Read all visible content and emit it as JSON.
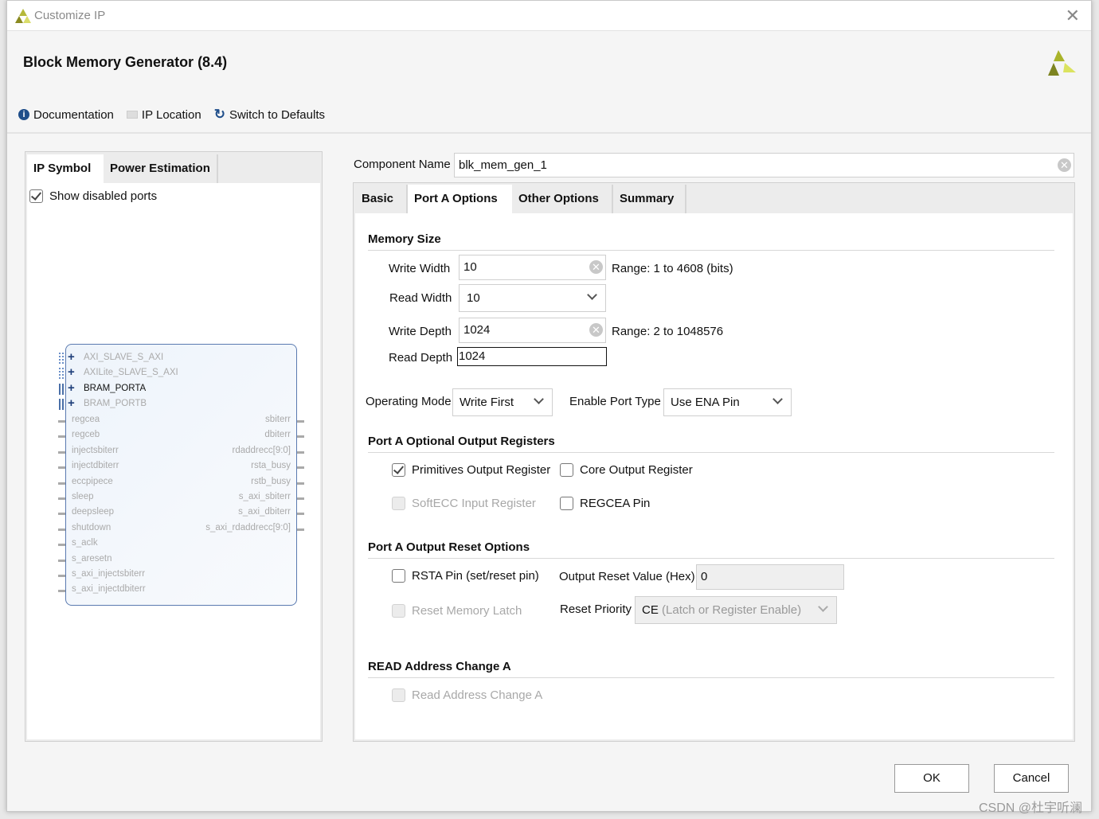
{
  "window": {
    "title": "Customize IP",
    "close_icon": "close-icon"
  },
  "header": {
    "title": "Block Memory Generator (8.4)"
  },
  "toolbar": {
    "documentation": "Documentation",
    "ip_location": "IP Location",
    "switch_defaults": "Switch to Defaults"
  },
  "left": {
    "tabs": [
      "IP Symbol",
      "Power Estimation"
    ],
    "show_disabled_ports": "Show disabled ports",
    "show_disabled_checked": true,
    "bus_ports": [
      {
        "name": "AXI_SLAVE_S_AXI",
        "enabled": false
      },
      {
        "name": "AXILite_SLAVE_S_AXI",
        "enabled": false
      },
      {
        "name": "BRAM_PORTA",
        "enabled": true
      },
      {
        "name": "BRAM_PORTB",
        "enabled": false
      }
    ],
    "left_ports": [
      "regcea",
      "regceb",
      "injectsbiterr",
      "injectdbiterr",
      "eccpipece",
      "sleep",
      "deepsleep",
      "shutdown",
      "s_aclk",
      "s_aresetn",
      "s_axi_injectsbiterr",
      "s_axi_injectdbiterr"
    ],
    "right_ports": [
      "sbiterr",
      "dbiterr",
      "rdaddrecc[9:0]",
      "rsta_busy",
      "rstb_busy",
      "s_axi_sbiterr",
      "s_axi_dbiterr",
      "s_axi_rdaddrecc[9:0]"
    ]
  },
  "component": {
    "label": "Component Name",
    "value": "blk_mem_gen_1"
  },
  "tabs": [
    "Basic",
    "Port A Options",
    "Other Options",
    "Summary"
  ],
  "memory_size": {
    "title": "Memory Size",
    "write_width_label": "Write Width",
    "write_width": "10",
    "write_width_range": "Range: 1 to 4608 (bits)",
    "read_width_label": "Read Width",
    "read_width": "10",
    "write_depth_label": "Write Depth",
    "write_depth": "1024",
    "write_depth_range": "Range: 2 to 1048576",
    "read_depth_label": "Read Depth",
    "read_depth": "1024"
  },
  "operating_mode": {
    "label": "Operating Mode",
    "value": "Write First"
  },
  "enable_port": {
    "label": "Enable Port Type",
    "value": "Use ENA Pin"
  },
  "output_registers": {
    "title": "Port A Optional Output Registers",
    "primitives": "Primitives Output Register",
    "core": "Core Output Register",
    "softecc": "SoftECC Input Register",
    "regcea": "REGCEA Pin"
  },
  "reset": {
    "title": "Port A Output Reset Options",
    "rsta": "RSTA Pin (set/reset pin)",
    "reset_value_label": "Output Reset Value (Hex)",
    "reset_value": "0",
    "reset_latch": "Reset Memory Latch",
    "priority_label": "Reset Priority",
    "priority_ce": "CE",
    "priority_rest": "(Latch or Register Enable)"
  },
  "read_addr": {
    "title": "READ Address Change A",
    "option": "Read Address Change A"
  },
  "buttons": {
    "ok": "OK",
    "cancel": "Cancel"
  },
  "watermark": "CSDN @杜宇听澜"
}
